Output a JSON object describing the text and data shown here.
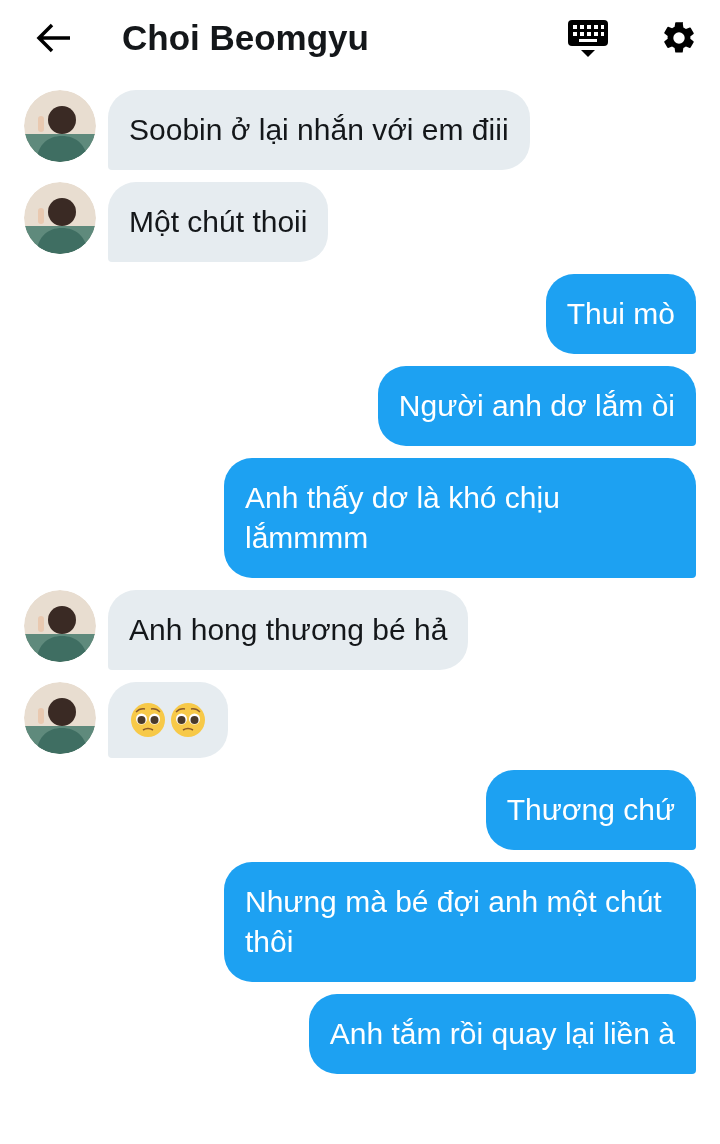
{
  "header": {
    "title": "Choi Beomgyu"
  },
  "messages": [
    {
      "outgoing": false,
      "kind": "text",
      "text": "Soobin ở lại nhắn với em điii"
    },
    {
      "outgoing": false,
      "kind": "text",
      "text": "Một chút thoii"
    },
    {
      "outgoing": true,
      "kind": "text",
      "text": "Thui mò"
    },
    {
      "outgoing": true,
      "kind": "text",
      "text": "Người anh dơ lắm òi"
    },
    {
      "outgoing": true,
      "kind": "text",
      "text": "Anh thấy dơ là khó chịu lắmmmm"
    },
    {
      "outgoing": false,
      "kind": "text",
      "text": "Anh hong thương bé hả"
    },
    {
      "outgoing": false,
      "kind": "emoji"
    },
    {
      "outgoing": true,
      "kind": "text",
      "text": "Thương chứ"
    },
    {
      "outgoing": true,
      "kind": "text",
      "text": "Nhưng mà bé đợi anh một chút thôi"
    },
    {
      "outgoing": true,
      "kind": "text",
      "text": "Anh tắm rồi quay lại liền à"
    }
  ]
}
